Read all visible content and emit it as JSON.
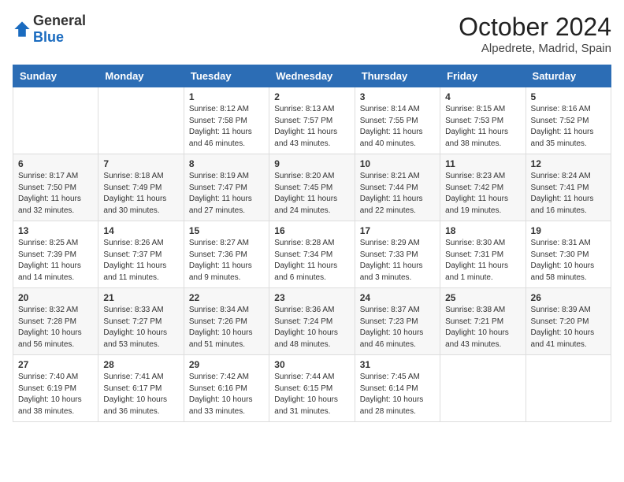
{
  "header": {
    "logo_general": "General",
    "logo_blue": "Blue",
    "month_year": "October 2024",
    "location": "Alpedrete, Madrid, Spain"
  },
  "weekdays": [
    "Sunday",
    "Monday",
    "Tuesday",
    "Wednesday",
    "Thursday",
    "Friday",
    "Saturday"
  ],
  "weeks": [
    [
      {
        "day": "",
        "info": ""
      },
      {
        "day": "",
        "info": ""
      },
      {
        "day": "1",
        "info": "Sunrise: 8:12 AM\nSunset: 7:58 PM\nDaylight: 11 hours and 46 minutes."
      },
      {
        "day": "2",
        "info": "Sunrise: 8:13 AM\nSunset: 7:57 PM\nDaylight: 11 hours and 43 minutes."
      },
      {
        "day": "3",
        "info": "Sunrise: 8:14 AM\nSunset: 7:55 PM\nDaylight: 11 hours and 40 minutes."
      },
      {
        "day": "4",
        "info": "Sunrise: 8:15 AM\nSunset: 7:53 PM\nDaylight: 11 hours and 38 minutes."
      },
      {
        "day": "5",
        "info": "Sunrise: 8:16 AM\nSunset: 7:52 PM\nDaylight: 11 hours and 35 minutes."
      }
    ],
    [
      {
        "day": "6",
        "info": "Sunrise: 8:17 AM\nSunset: 7:50 PM\nDaylight: 11 hours and 32 minutes."
      },
      {
        "day": "7",
        "info": "Sunrise: 8:18 AM\nSunset: 7:49 PM\nDaylight: 11 hours and 30 minutes."
      },
      {
        "day": "8",
        "info": "Sunrise: 8:19 AM\nSunset: 7:47 PM\nDaylight: 11 hours and 27 minutes."
      },
      {
        "day": "9",
        "info": "Sunrise: 8:20 AM\nSunset: 7:45 PM\nDaylight: 11 hours and 24 minutes."
      },
      {
        "day": "10",
        "info": "Sunrise: 8:21 AM\nSunset: 7:44 PM\nDaylight: 11 hours and 22 minutes."
      },
      {
        "day": "11",
        "info": "Sunrise: 8:23 AM\nSunset: 7:42 PM\nDaylight: 11 hours and 19 minutes."
      },
      {
        "day": "12",
        "info": "Sunrise: 8:24 AM\nSunset: 7:41 PM\nDaylight: 11 hours and 16 minutes."
      }
    ],
    [
      {
        "day": "13",
        "info": "Sunrise: 8:25 AM\nSunset: 7:39 PM\nDaylight: 11 hours and 14 minutes."
      },
      {
        "day": "14",
        "info": "Sunrise: 8:26 AM\nSunset: 7:37 PM\nDaylight: 11 hours and 11 minutes."
      },
      {
        "day": "15",
        "info": "Sunrise: 8:27 AM\nSunset: 7:36 PM\nDaylight: 11 hours and 9 minutes."
      },
      {
        "day": "16",
        "info": "Sunrise: 8:28 AM\nSunset: 7:34 PM\nDaylight: 11 hours and 6 minutes."
      },
      {
        "day": "17",
        "info": "Sunrise: 8:29 AM\nSunset: 7:33 PM\nDaylight: 11 hours and 3 minutes."
      },
      {
        "day": "18",
        "info": "Sunrise: 8:30 AM\nSunset: 7:31 PM\nDaylight: 11 hours and 1 minute."
      },
      {
        "day": "19",
        "info": "Sunrise: 8:31 AM\nSunset: 7:30 PM\nDaylight: 10 hours and 58 minutes."
      }
    ],
    [
      {
        "day": "20",
        "info": "Sunrise: 8:32 AM\nSunset: 7:28 PM\nDaylight: 10 hours and 56 minutes."
      },
      {
        "day": "21",
        "info": "Sunrise: 8:33 AM\nSunset: 7:27 PM\nDaylight: 10 hours and 53 minutes."
      },
      {
        "day": "22",
        "info": "Sunrise: 8:34 AM\nSunset: 7:26 PM\nDaylight: 10 hours and 51 minutes."
      },
      {
        "day": "23",
        "info": "Sunrise: 8:36 AM\nSunset: 7:24 PM\nDaylight: 10 hours and 48 minutes."
      },
      {
        "day": "24",
        "info": "Sunrise: 8:37 AM\nSunset: 7:23 PM\nDaylight: 10 hours and 46 minutes."
      },
      {
        "day": "25",
        "info": "Sunrise: 8:38 AM\nSunset: 7:21 PM\nDaylight: 10 hours and 43 minutes."
      },
      {
        "day": "26",
        "info": "Sunrise: 8:39 AM\nSunset: 7:20 PM\nDaylight: 10 hours and 41 minutes."
      }
    ],
    [
      {
        "day": "27",
        "info": "Sunrise: 7:40 AM\nSunset: 6:19 PM\nDaylight: 10 hours and 38 minutes."
      },
      {
        "day": "28",
        "info": "Sunrise: 7:41 AM\nSunset: 6:17 PM\nDaylight: 10 hours and 36 minutes."
      },
      {
        "day": "29",
        "info": "Sunrise: 7:42 AM\nSunset: 6:16 PM\nDaylight: 10 hours and 33 minutes."
      },
      {
        "day": "30",
        "info": "Sunrise: 7:44 AM\nSunset: 6:15 PM\nDaylight: 10 hours and 31 minutes."
      },
      {
        "day": "31",
        "info": "Sunrise: 7:45 AM\nSunset: 6:14 PM\nDaylight: 10 hours and 28 minutes."
      },
      {
        "day": "",
        "info": ""
      },
      {
        "day": "",
        "info": ""
      }
    ]
  ]
}
